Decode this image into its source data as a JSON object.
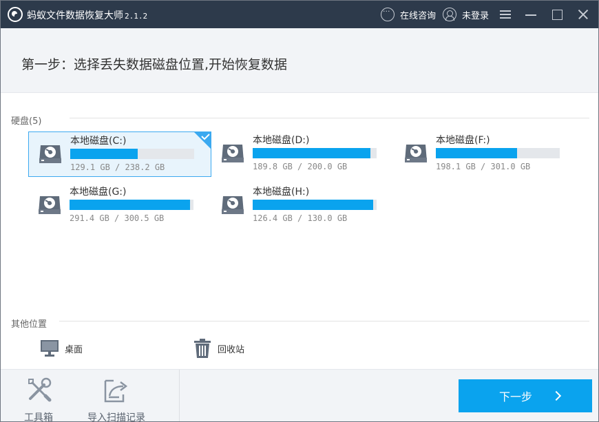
{
  "window": {
    "app_title": "蚂蚁文件数据恢复大师",
    "version": "2.1.2",
    "consult_label": "在线咨询",
    "login_label": "未登录"
  },
  "step": {
    "title": "第一步：选择丢失数据磁盘位置,开始恢复数据"
  },
  "disks_section": {
    "label": "硬盘(5)",
    "disks": [
      {
        "name": "本地磁盘(C:)",
        "size_text": "129.1 GB / 238.2 GB",
        "used_fraction": 0.542,
        "selected": true
      },
      {
        "name": "本地磁盘(D:)",
        "size_text": "189.8 GB / 200.0 GB",
        "used_fraction": 0.949,
        "selected": false
      },
      {
        "name": "本地磁盘(F:)",
        "size_text": "198.1 GB / 301.0 GB",
        "used_fraction": 0.658,
        "selected": false
      },
      {
        "name": "本地磁盘(G:)",
        "size_text": "291.4 GB / 300.5 GB",
        "used_fraction": 0.97,
        "selected": false
      },
      {
        "name": "本地磁盘(H:)",
        "size_text": "126.4 GB / 130.0 GB",
        "used_fraction": 0.972,
        "selected": false
      }
    ]
  },
  "other_section": {
    "label": "其他位置",
    "places": [
      {
        "label": "桌面",
        "icon": "desktop-monitor-icon"
      },
      {
        "label": "回收站",
        "icon": "recycle-bin-icon"
      }
    ]
  },
  "footer": {
    "toolbox_label": "工具箱",
    "import_label": "导入扫描记录",
    "next_label": "下一步"
  },
  "colors": {
    "titlebar": "#2d3a4b",
    "accent": "#0aa3ee",
    "bar_track": "#e4e7eb",
    "selected_bg": "#e8f4fc",
    "header_bg": "#f2f4f7"
  }
}
